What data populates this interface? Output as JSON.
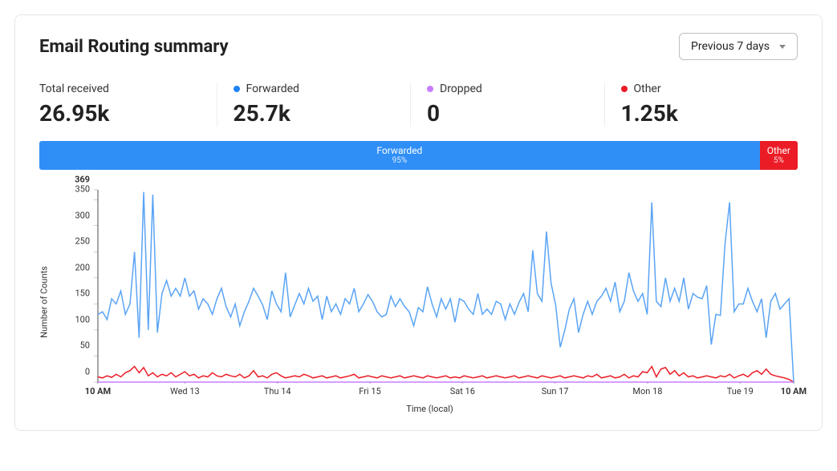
{
  "title": "Email Routing summary",
  "dropdown": {
    "selected": "Previous 7 days"
  },
  "colors": {
    "forwarded": "#1f83f7",
    "dropped": "#c77dff",
    "other": "#eb1c26"
  },
  "metrics": [
    {
      "key": "total",
      "label": "Total received",
      "value": "26.95k",
      "dot": null
    },
    {
      "key": "forwarded",
      "label": "Forwarded",
      "value": "25.7k",
      "dot": "#1f83f7"
    },
    {
      "key": "dropped",
      "label": "Dropped",
      "value": "0",
      "dot": "#c77dff"
    },
    {
      "key": "other",
      "label": "Other",
      "value": "1.25k",
      "dot": "#eb1c26"
    }
  ],
  "bar": [
    {
      "label": "Forwarded",
      "pct": "95%",
      "width": 95,
      "color": "#2f8ff7"
    },
    {
      "label": "Other",
      "pct": "5%",
      "width": 5,
      "color": "#eb1c26"
    }
  ],
  "chart_data": {
    "type": "line",
    "ylabel": "Number of Counts",
    "xlabel": "Time (local)",
    "ylim": [
      0,
      369
    ],
    "y_ticks": [
      0,
      50,
      100,
      150,
      200,
      250,
      300,
      350,
      369
    ],
    "x_ticks": [
      {
        "pos": 0.0,
        "label": "10 AM",
        "bold": true
      },
      {
        "pos": 0.125,
        "label": "Wed 13"
      },
      {
        "pos": 0.258,
        "label": "Thu 14"
      },
      {
        "pos": 0.391,
        "label": "Fri 15"
      },
      {
        "pos": 0.524,
        "label": "Sat 16"
      },
      {
        "pos": 0.657,
        "label": "Sun 17"
      },
      {
        "pos": 0.79,
        "label": "Mon 18"
      },
      {
        "pos": 0.923,
        "label": "Tue 19"
      },
      {
        "pos": 1.0,
        "label": "10 AM",
        "bold": true
      }
    ],
    "series": [
      {
        "name": "Forwarded",
        "color": "#5aa4f5",
        "values": [
          130,
          135,
          120,
          160,
          150,
          175,
          130,
          150,
          250,
          85,
          365,
          100,
          360,
          95,
          170,
          195,
          165,
          180,
          165,
          200,
          165,
          175,
          140,
          160,
          150,
          130,
          160,
          180,
          145,
          125,
          150,
          108,
          135,
          155,
          180,
          165,
          148,
          120,
          175,
          150,
          135,
          210,
          125,
          148,
          170,
          150,
          180,
          155,
          165,
          120,
          165,
          135,
          150,
          130,
          160,
          150,
          180,
          135,
          150,
          168,
          155,
          135,
          125,
          130,
          165,
          145,
          160,
          145,
          135,
          108,
          143,
          135,
          183,
          150,
          125,
          160,
          140,
          160,
          115,
          160,
          155,
          140,
          130,
          170,
          130,
          140,
          130,
          155,
          150,
          120,
          150,
          130,
          153,
          170,
          135,
          253,
          170,
          155,
          289,
          190,
          148,
          67,
          100,
          140,
          160,
          95,
          130,
          155,
          130,
          155,
          165,
          180,
          155,
          192,
          135,
          155,
          210,
          175,
          155,
          170,
          130,
          345,
          155,
          145,
          200,
          155,
          180,
          155,
          200,
          140,
          170,
          163,
          160,
          185,
          72,
          130,
          128,
          265,
          345,
          135,
          150,
          150,
          180,
          155,
          135,
          160,
          85,
          155,
          170,
          140,
          150,
          160,
          0
        ]
      },
      {
        "name": "Other",
        "color": "#eb1c26",
        "values": [
          10,
          8,
          12,
          9,
          15,
          10,
          18,
          22,
          30,
          18,
          28,
          12,
          18,
          10,
          15,
          12,
          18,
          10,
          15,
          20,
          12,
          15,
          8,
          12,
          10,
          18,
          12,
          10,
          15,
          12,
          10,
          15,
          8,
          12,
          22,
          10,
          12,
          8,
          15,
          18,
          12,
          8,
          10,
          12,
          10,
          15,
          12,
          8,
          10,
          12,
          8,
          10,
          12,
          8,
          10,
          12,
          15,
          8,
          10,
          12,
          10,
          8,
          12,
          10,
          8,
          10,
          12,
          8,
          10,
          12,
          10,
          8,
          12,
          10,
          8,
          10,
          12,
          8,
          10,
          8,
          12,
          10,
          8,
          10,
          12,
          8,
          10,
          12,
          10,
          8,
          10,
          12,
          8,
          10,
          12,
          10,
          8,
          12,
          10,
          8,
          10,
          12,
          8,
          10,
          12,
          10,
          8,
          12,
          10,
          15,
          8,
          10,
          12,
          8,
          10,
          15,
          8,
          12,
          10,
          20,
          18,
          30,
          10,
          25,
          28,
          15,
          22,
          12,
          18,
          10,
          12,
          8,
          10,
          12,
          10,
          8,
          12,
          10,
          15,
          8,
          12,
          15,
          10,
          18,
          22,
          15,
          25,
          15,
          12,
          10,
          8,
          5,
          0
        ]
      },
      {
        "name": "Dropped",
        "color": "#c77dff",
        "values": [
          0,
          0,
          0,
          0,
          0,
          0,
          0,
          0,
          0,
          0,
          0,
          0,
          0,
          0,
          0,
          0,
          0,
          0,
          0,
          0,
          0,
          0,
          0,
          0,
          0,
          0,
          0,
          0,
          0,
          0,
          0,
          0,
          0,
          0,
          0,
          0,
          0,
          0,
          0,
          0,
          0,
          0,
          0,
          0,
          0,
          0,
          0,
          0,
          0,
          0,
          0,
          0,
          0,
          0,
          0,
          0,
          0,
          0,
          0,
          0,
          0,
          0,
          0,
          0,
          0,
          0,
          0,
          0,
          0,
          0,
          0,
          0,
          0,
          0,
          0,
          0,
          0,
          0,
          0,
          0,
          0,
          0,
          0,
          0,
          0,
          0,
          0,
          0,
          0,
          0,
          0,
          0,
          0,
          0,
          0,
          0,
          0,
          0,
          0,
          0,
          0,
          0,
          0,
          0,
          0,
          0,
          0,
          0,
          0,
          0,
          0,
          0,
          0,
          0,
          0,
          0,
          0,
          0,
          0,
          0,
          0,
          0,
          0,
          0,
          0,
          0,
          0,
          0,
          0,
          0,
          0,
          0,
          0,
          0,
          0,
          0,
          0,
          0,
          0,
          0,
          0,
          0,
          0,
          0,
          0,
          0,
          0,
          0,
          0,
          0,
          0,
          0,
          0
        ]
      }
    ]
  }
}
